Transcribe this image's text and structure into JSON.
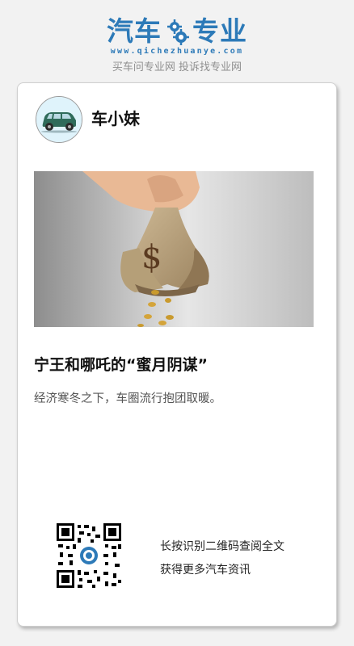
{
  "site": {
    "logo_left": "汽车",
    "logo_right": "专业",
    "domain": "www.qichezhuanye.com",
    "slogan": "买车问专业网 投诉找专业网",
    "brand_color": "#2d7ab8"
  },
  "author": {
    "name": "车小妹",
    "avatar_icon": "car-icon"
  },
  "article": {
    "hero_icon": "money-bag-icon",
    "title": "宁王和哪吒的“蜜月阴谋”",
    "summary": "经济寒冬之下，车圈流行抱团取暖。"
  },
  "qr": {
    "icon": "qr-code-icon",
    "line1": "长按识别二维码查阅全文",
    "line2": "获得更多汽车资讯"
  }
}
